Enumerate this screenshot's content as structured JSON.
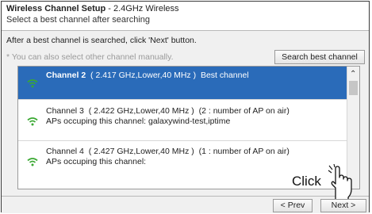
{
  "header": {
    "title_bold": "Wireless Channel Setup",
    "title_rest": " - 2.4GHz Wireless",
    "subtitle": "Select a best channel after searching"
  },
  "body": {
    "instruction": "After a best channel is searched, click 'Next' button.",
    "note": "* You can also select other channel manually.",
    "search_button": "Search best channel"
  },
  "channels": [
    {
      "name": "Channel 2",
      "detail": "( 2.417 GHz,Lower,40 MHz )",
      "status": "Best channel",
      "aps": "",
      "selected": true
    },
    {
      "name": "Channel 3",
      "detail": "( 2.422 GHz,Lower,40 MHz )",
      "status": "(2 : number of AP on air)",
      "aps": "APs occuping this channel: galaxywind-test,iptime",
      "selected": false
    },
    {
      "name": "Channel 4",
      "detail": "( 2.427 GHz,Lower,40 MHz )",
      "status": "(1 : number of AP on air)",
      "aps": "APs occuping this channel:",
      "selected": false
    }
  ],
  "footer": {
    "prev_label": "< Prev",
    "next_label": "Next >"
  },
  "annotation": {
    "click_label": "Click"
  },
  "colors": {
    "selected_row": "#2a6bb9",
    "wifi_icon": "#3aa832"
  },
  "icons": {
    "channel_signal": "wifi-icon",
    "scroll_up": "chevron-up-icon",
    "pointer": "hand-pointer-icon"
  }
}
